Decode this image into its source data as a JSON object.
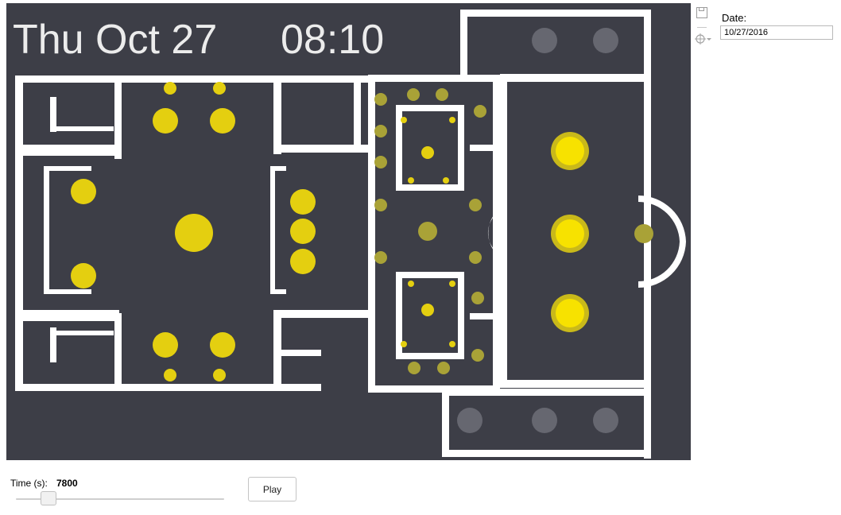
{
  "clock": {
    "date": "Thu Oct 27",
    "time": "08:10"
  },
  "date_field": {
    "label": "Date:",
    "value": "10/27/2016"
  },
  "time_control": {
    "label": "Time (s):",
    "value": "7800",
    "slider_position_fraction": 0.13
  },
  "play_button": {
    "label": "Play"
  },
  "toolbar": {
    "icons": [
      "save-icon",
      "crosshair-icon"
    ]
  },
  "colors": {
    "map_background": "#3d3e47",
    "walls": "#ffffff",
    "occupancy_high": "#f7e200",
    "occupancy_mid": "#e4cf10",
    "occupancy_low": "#a9a237",
    "occupancy_none": "#666770"
  }
}
